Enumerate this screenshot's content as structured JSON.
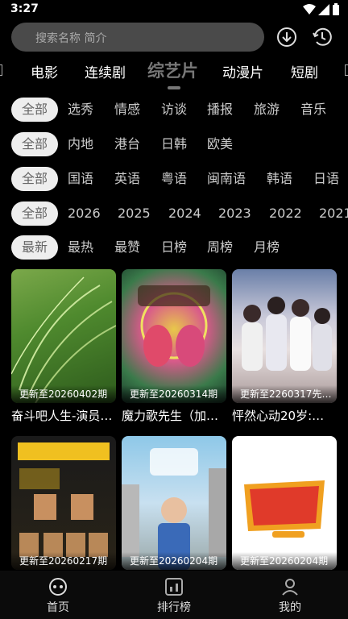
{
  "status_bar": {
    "time": "3:27"
  },
  "search": {
    "placeholder": "搜索名称 简介"
  },
  "category_tabs": [
    {
      "label": "电影"
    },
    {
      "label": "连续剧"
    },
    {
      "label": "综艺片"
    },
    {
      "label": "动漫片"
    },
    {
      "label": "短剧"
    }
  ],
  "active_category": "综艺片",
  "filters": {
    "type": [
      "全部",
      "选秀",
      "情感",
      "访谈",
      "播报",
      "旅游",
      "音乐"
    ],
    "region": [
      "全部",
      "内地",
      "港台",
      "日韩",
      "欧美"
    ],
    "language": [
      "全部",
      "国语",
      "英语",
      "粤语",
      "闽南语",
      "韩语",
      "日语"
    ],
    "year": [
      "全部",
      "2026",
      "2025",
      "2024",
      "2023",
      "2022",
      "2021"
    ],
    "sort": [
      "最新",
      "最热",
      "最赞",
      "日榜",
      "周榜",
      "月榜"
    ]
  },
  "cards": [
    {
      "title": "奋斗吧人生-演员…",
      "update": "更新至20260402期"
    },
    {
      "title": "魔力歌先生（加…",
      "update": "更新至20260314期"
    },
    {
      "title": "怦然心动20岁:…",
      "update": "更新至2260317先…"
    },
    {
      "title": "",
      "update": "更新至20260217期"
    },
    {
      "title": "",
      "update": "更新至20260204期"
    },
    {
      "title": "",
      "update": "更新至20260204期"
    }
  ],
  "bottom_nav": {
    "home": "首页",
    "ranking": "排行榜",
    "mine": "我的"
  },
  "colors": {
    "background": "#000000",
    "chip_active_bg": "#eeeeee",
    "search_bg": "#4a4a4a"
  }
}
